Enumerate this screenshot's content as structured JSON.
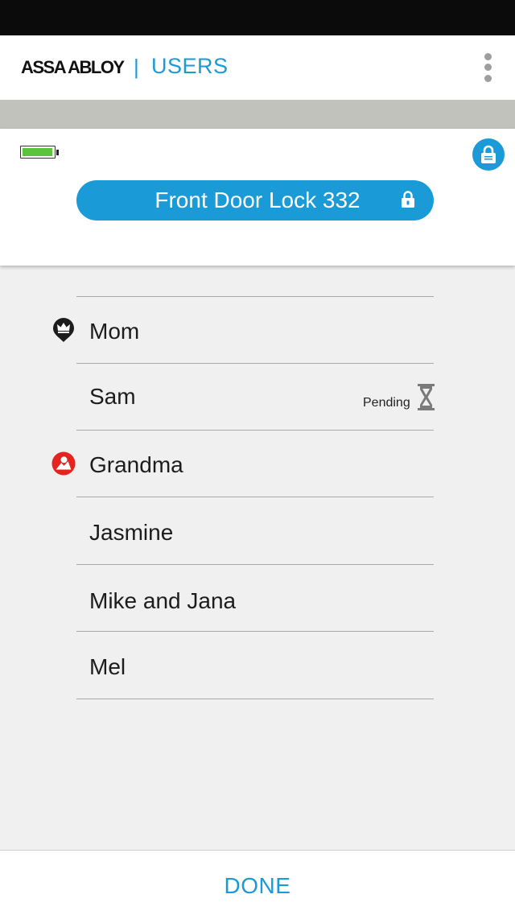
{
  "header": {
    "brand": "ASSA ABLOY",
    "separator": "|",
    "title": "USERS",
    "menu_icon": "more-vert-icon"
  },
  "lock": {
    "name": "Front Door Lock 332",
    "battery_level": 1.0,
    "battery_color": "#5cc33c",
    "status_icon": "padlock-icon",
    "accent_color": "#1a9ad6"
  },
  "users": [
    {
      "name": "Mom",
      "badge": "crown-icon",
      "status": ""
    },
    {
      "name": "Sam",
      "badge": "",
      "status": "Pending",
      "status_icon": "hourglass-icon"
    },
    {
      "name": "Grandma",
      "badge": "person-red-icon",
      "status": ""
    },
    {
      "name": "Jasmine",
      "badge": "",
      "status": ""
    },
    {
      "name": "Mike and Jana",
      "badge": "",
      "status": ""
    },
    {
      "name": "Mel",
      "badge": "",
      "status": ""
    }
  ],
  "footer": {
    "done_label": "DONE"
  }
}
